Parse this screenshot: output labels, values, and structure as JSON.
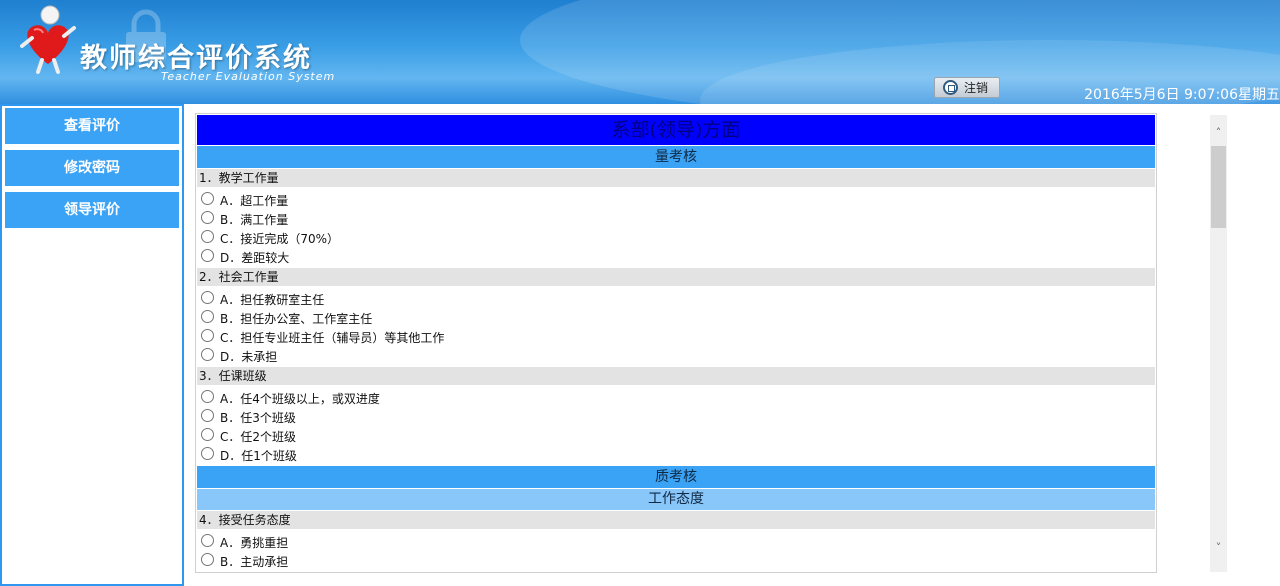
{
  "header": {
    "title": "教师综合评价系统",
    "subtitle": "Teacher Evaluation System",
    "logout_label": "注销",
    "datetime": "2016年5月6日 9:07:06星期五"
  },
  "sidebar": {
    "items": [
      {
        "label": "查看评价"
      },
      {
        "label": "修改密码"
      },
      {
        "label": "领导评价"
      }
    ]
  },
  "form": {
    "banner": "系部(领导)方面",
    "section_quantity": "量考核",
    "questions": [
      {
        "title": "1．教学工作量",
        "options": [
          "A．超工作量",
          "B．满工作量",
          "C．接近完成（70%）",
          "D．差距较大"
        ]
      },
      {
        "title": "2．社会工作量",
        "options": [
          "A．担任教研室主任",
          "B．担任办公室、工作室主任",
          "C．担任专业班主任（辅导员）等其他工作",
          "D．未承担"
        ]
      },
      {
        "title": "3．任课班级",
        "options": [
          "A．任4个班级以上，或双进度",
          "B．任3个班级",
          "C．任2个班级",
          "D．任1个班级"
        ]
      }
    ],
    "section_quality": "质考核",
    "subsection_attitude": "工作态度",
    "question4": {
      "title": "4．接受任务态度",
      "options": [
        "A．勇挑重担",
        "B．主动承担"
      ]
    }
  },
  "colors": {
    "header_blue": "#3a9ee6",
    "sidebar_button": "#3ba3f5",
    "banner_blue": "#0000ff",
    "section_blue": "#3ba3f5",
    "subsection_blue": "#89c7fb",
    "question_gray": "#e3e3e3"
  },
  "icons": {
    "logo": "heart-mascot-icon",
    "logout": "logout-icon",
    "scroll_up": "chevron-up-icon",
    "scroll_down": "chevron-down-icon"
  }
}
